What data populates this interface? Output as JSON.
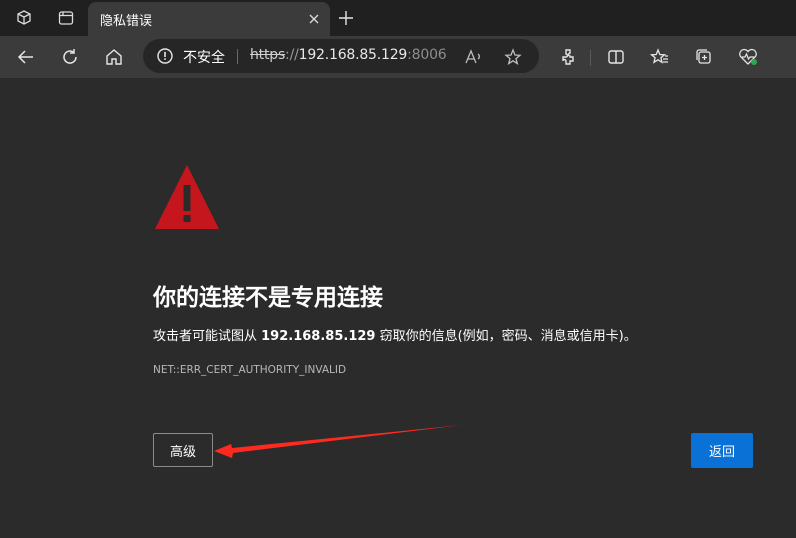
{
  "tab": {
    "title": "隐私错误"
  },
  "address": {
    "security_label": "不安全",
    "scheme": "https",
    "separator": "://",
    "host": "192.168.85.129",
    "port": ":8006"
  },
  "page": {
    "heading": "你的连接不是专用连接",
    "desc_prefix": "攻击者可能试图从 ",
    "desc_host": "192.168.85.129",
    "desc_suffix": " 窃取你的信息(例如，密码、消息或信用卡)。",
    "error_code": "NET::ERR_CERT_AUTHORITY_INVALID",
    "advanced_label": "高级",
    "back_label": "返回"
  },
  "colors": {
    "warning_red": "#c4161c",
    "primary_blue": "#0a72d6",
    "annotation_arrow": "#ff2a1f"
  },
  "icons": [
    "workspaces-icon",
    "tab-actions-icon",
    "close-icon",
    "new-tab-icon",
    "back-icon",
    "refresh-icon",
    "home-icon",
    "not-secure-icon",
    "read-aloud-icon",
    "favorite-icon",
    "extensions-icon",
    "split-screen-icon",
    "favorites-icon",
    "collections-icon",
    "browser-essentials-icon",
    "warning-triangle-icon"
  ]
}
